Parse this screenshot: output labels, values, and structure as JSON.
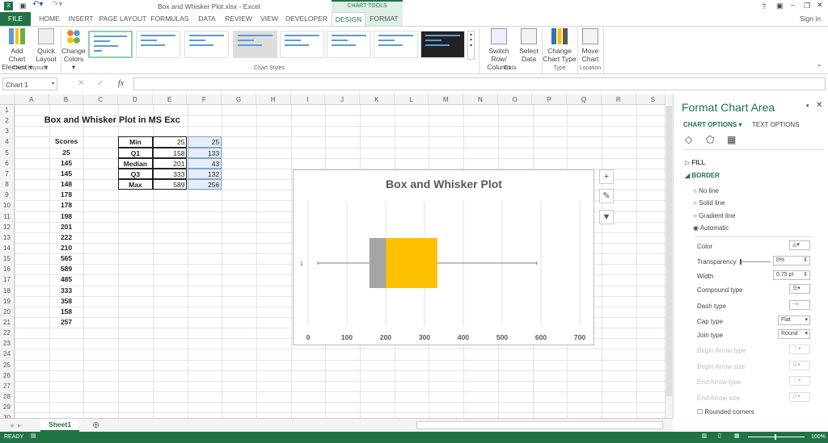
{
  "window": {
    "title": "Box and Whisker Plot.xlsx - Excel",
    "context_group": "CHART TOOLS",
    "sign_in": "Sign in",
    "help": "?"
  },
  "tabs": [
    "FILE",
    "HOME",
    "INSERT",
    "PAGE LAYOUT",
    "FORMULAS",
    "DATA",
    "REVIEW",
    "VIEW",
    "DEVELOPER",
    "DESIGN",
    "FORMAT"
  ],
  "ribbon": {
    "add_chart_element": [
      "Add Chart",
      "Element ▾"
    ],
    "quick_layout": [
      "Quick",
      "Layout ▾"
    ],
    "chart_layouts": "Chart Layouts",
    "change_colors": [
      "Change",
      "Colors ▾"
    ],
    "chart_styles": "Chart Styles",
    "switch_row_col": [
      "Switch Row/",
      "Column"
    ],
    "select_data": [
      "Select",
      "Data"
    ],
    "data_group": "Data",
    "change_chart_type": [
      "Change",
      "Chart Type"
    ],
    "type_group": "Type",
    "move_chart": [
      "Move",
      "Chart"
    ],
    "location_group": "Location"
  },
  "formula_bar": {
    "name_box": "Chart 1",
    "fx": "fx",
    "value": ""
  },
  "columns": [
    "A",
    "B",
    "C",
    "D",
    "E",
    "F",
    "G",
    "H",
    "I",
    "J",
    "K",
    "L",
    "M",
    "N",
    "O",
    "P",
    "Q",
    "R",
    "S"
  ],
  "sheet": {
    "heading": "Box and Whisker Plot in MS Excel",
    "scores_header": "Scores",
    "scores": [
      "25",
      "145",
      "145",
      "148",
      "178",
      "178",
      "198",
      "201",
      "222",
      "210",
      "565",
      "589",
      "485",
      "333",
      "358",
      "158",
      "257"
    ],
    "stats": [
      [
        "Min",
        "25",
        "25"
      ],
      [
        "Q1",
        "158",
        "133"
      ],
      [
        "Median",
        "201",
        "43"
      ],
      [
        "Q3",
        "333",
        "132"
      ],
      [
        "Max",
        "589",
        "256"
      ]
    ]
  },
  "chart_data": {
    "type": "box",
    "title": "Box and Whisker Plot",
    "category": "1",
    "min": 25,
    "q1": 158,
    "median": 201,
    "q3": 333,
    "max": 589,
    "xlim": [
      0,
      700
    ],
    "xticks": [
      "0",
      "100",
      "200",
      "300",
      "400",
      "500",
      "600",
      "700"
    ],
    "grid": "vertical",
    "colors": {
      "lower_box": "#a5a5a5",
      "upper_box": "#ffc000",
      "whisker": "#7f7f7f"
    }
  },
  "panel": {
    "title": "Format Chart Area",
    "chart_options": "CHART OPTIONS ▾",
    "text_options": "TEXT OPTIONS",
    "fill": "FILL",
    "border": "BORDER",
    "radios": [
      "No line",
      "Solid line",
      "Gradient line",
      "Automatic"
    ],
    "selected": "Automatic",
    "color": "Color",
    "transparency": "Transparency",
    "transparency_value": "0%",
    "width": "Width",
    "width_value": "0.75 pt",
    "compound": "Compound type",
    "dash": "Dash type",
    "cap": "Cap type",
    "cap_value": "Flat",
    "join": "Join type",
    "join_value": "Round",
    "begin_arrow_type": "Begin Arrow type",
    "begin_arrow_size": "Begin Arrow size",
    "end_arrow_type": "End Arrow type",
    "end_arrow_size": "End Arrow size",
    "rounded": "Rounded corners"
  },
  "sheet_tab": "Sheet1",
  "status": {
    "ready": "READY",
    "zoom": "100%"
  }
}
